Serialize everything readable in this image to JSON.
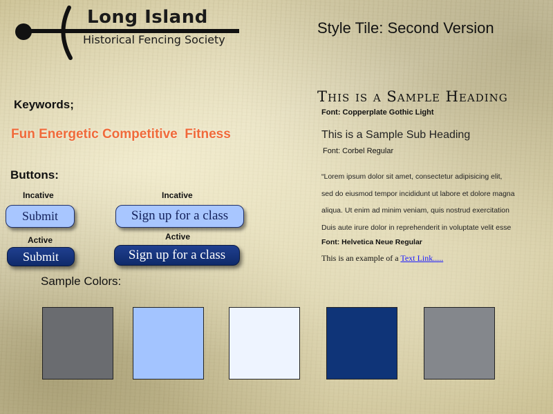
{
  "logo": {
    "line1": "Long Island",
    "line2": "Historical Fencing Society"
  },
  "title": "Style Tile: Second Version",
  "keywords": {
    "label": "Keywords;",
    "words": "Fun Energetic Competitive  Fitness"
  },
  "buttons": {
    "label": "Buttons:",
    "inactive_label": "Incative",
    "active_label": "Active",
    "submit": "Submit",
    "signup": "Sign up for a class"
  },
  "typography": {
    "heading": "This is a Sample Heading",
    "heading_font": "Font: Copperplate Gothic Light",
    "subheading": "This is a Sample Sub Heading",
    "subheading_font": "Font: Corbel Regular",
    "body_lines": [
      "“Lorem ipsum dolor sit amet, consectetur adipisicing elit,",
      "sed do eiusmod tempor incididunt ut labore et dolore magna",
      "aliqua. Ut enim ad minim veniam, quis nostrud exercitation",
      "Duis aute irure dolor in reprehenderit in voluptate velit esse"
    ],
    "body_font": "Font: Helvetica Neue Regular",
    "link_prefix": "This is an example of a ",
    "link_text": "Text Link....."
  },
  "colors": {
    "label": "Sample Colors:",
    "swatches": [
      "#6a6c70",
      "#a3c4ff",
      "#eef4ff",
      "#0f3478",
      "#84878c"
    ]
  }
}
